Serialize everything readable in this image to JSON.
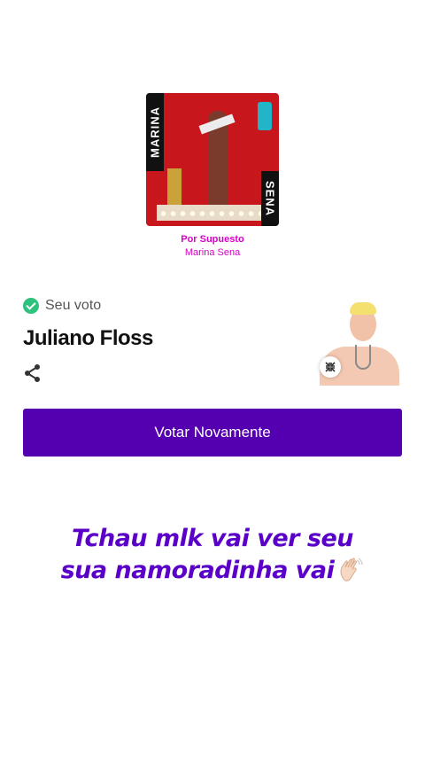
{
  "album": {
    "left_text": "MARINA",
    "right_text": "SENA",
    "song_title": "Por Supuesto",
    "artist": "Marina Sena",
    "accent_color": "#d900c8"
  },
  "vote": {
    "status_label": "Seu voto",
    "candidate_name": "Juliano Floss",
    "share_icon": "share-icon",
    "expand_icon": "expand-icon",
    "button_label": "Votar Novamente",
    "button_color": "#5400b0",
    "check_color": "#2ec27e"
  },
  "caption": {
    "line1": "Tchau mlk vai ver seu",
    "line2": "sua namoradinha vai",
    "emoji": "👋🏻",
    "color": "#5a00c8"
  }
}
